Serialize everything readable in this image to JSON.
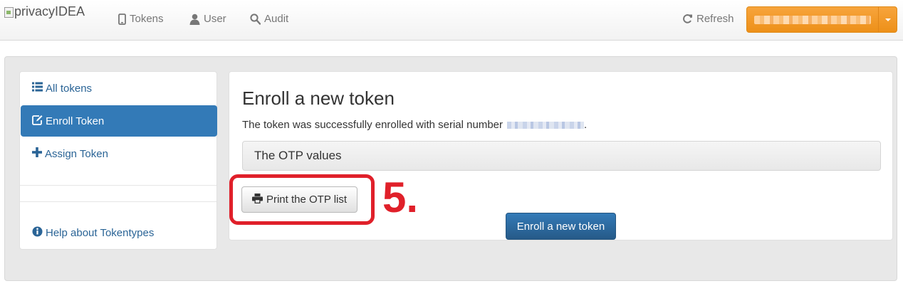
{
  "navbar": {
    "brand": "privacyIDEA",
    "items": [
      {
        "label": "Tokens",
        "icon": "mobile-icon"
      },
      {
        "label": "User",
        "icon": "user-icon"
      },
      {
        "label": "Audit",
        "icon": "search-icon"
      }
    ],
    "refresh_label": "Refresh",
    "user_menu_label": ""
  },
  "sidebar": {
    "items": [
      {
        "label": "All tokens",
        "icon": "list-icon"
      },
      {
        "label": "Enroll Token",
        "icon": "edit-icon"
      },
      {
        "label": "Assign Token",
        "icon": "plus-icon"
      }
    ],
    "help_label": "Help about Tokentypes"
  },
  "main": {
    "title": "Enroll a new token",
    "success_text": "The token was successfully enrolled with serial number",
    "serial_suffix": ".",
    "otp_panel_title": "The OTP values",
    "print_button": "Print the OTP list",
    "enroll_button": "Enroll a new token"
  },
  "annotation": {
    "step_label": "5.",
    "color": "#e0202a"
  },
  "colors": {
    "primary": "#337ab7",
    "user_button": "#f0961f"
  }
}
